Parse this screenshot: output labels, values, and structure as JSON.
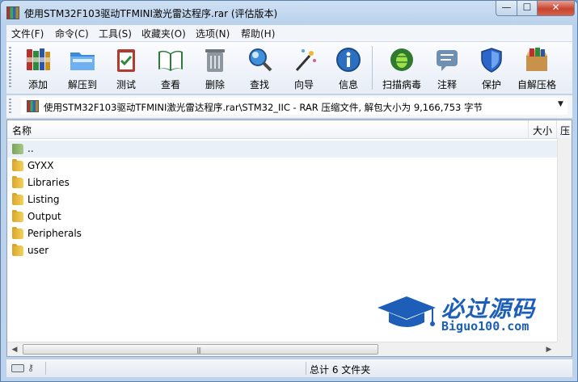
{
  "window": {
    "title": "使用STM32F103驱动TFMINI激光雷达程序.rar (评估版本)",
    "controls": {
      "minimize": "—",
      "maximize": "☐",
      "close": "✕"
    }
  },
  "menu": [
    "文件(F)",
    "命令(C)",
    "工具(S)",
    "收藏夹(O)",
    "选项(N)",
    "帮助(H)"
  ],
  "toolbar": {
    "buttons": [
      {
        "label": "添加",
        "icon": "books-add-icon"
      },
      {
        "label": "解压到",
        "icon": "folder-extract-icon"
      },
      {
        "label": "测试",
        "icon": "clipboard-test-icon"
      },
      {
        "label": "查看",
        "icon": "book-view-icon"
      },
      {
        "label": "删除",
        "icon": "trash-icon"
      },
      {
        "label": "查找",
        "icon": "magnifier-icon"
      },
      {
        "label": "向导",
        "icon": "magic-wand-icon"
      },
      {
        "label": "信息",
        "icon": "info-icon"
      },
      {
        "label": "扫描病毒",
        "icon": "bug-scan-icon"
      },
      {
        "label": "注释",
        "icon": "comment-icon"
      },
      {
        "label": "保护",
        "icon": "shield-icon"
      },
      {
        "label": "自解压格",
        "icon": "box-sfx-icon"
      }
    ]
  },
  "address": {
    "path": "使用STM32F103驱动TFMINI激光雷达程序.rar\\STM32_IIC - RAR 压缩文件, 解包大小为 9,166,753 字节",
    "dropdown": "▼"
  },
  "filelist": {
    "columns": {
      "name": "名称",
      "size": "大小",
      "packed": "压"
    },
    "rows": [
      {
        "name": "..",
        "type": "up"
      },
      {
        "name": "GYXX",
        "type": "folder"
      },
      {
        "name": "Libraries",
        "type": "folder"
      },
      {
        "name": "Listing",
        "type": "folder"
      },
      {
        "name": "Output",
        "type": "folder"
      },
      {
        "name": "Peripherals",
        "type": "folder"
      },
      {
        "name": "user",
        "type": "folder"
      }
    ],
    "scroll": {
      "left": "◀",
      "right": "▶",
      "grip": "|||"
    }
  },
  "watermark": {
    "title": "必过源码",
    "url": "Biguo100.com"
  },
  "status": {
    "text": "总计 6 文件夹"
  },
  "colors": {
    "accent": "#1d5fb8",
    "folder": "#e8bb3a",
    "titlebar": "#c6dbf1"
  }
}
